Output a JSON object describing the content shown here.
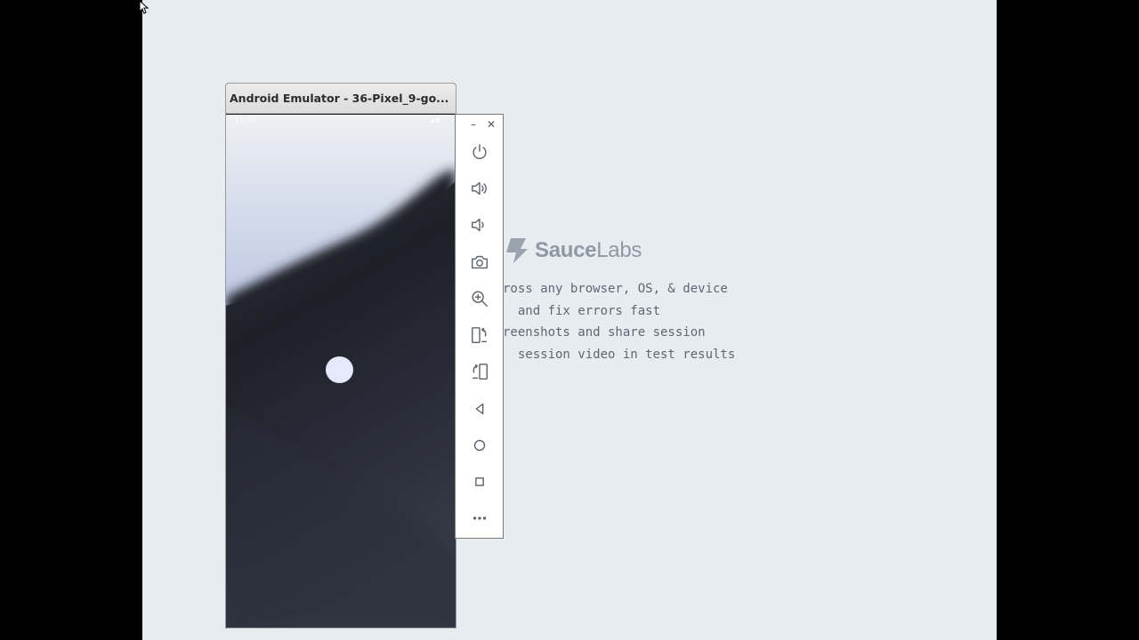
{
  "emulator": {
    "title": "Android Emulator - 36-Pixel_9-go...",
    "status_time": "11:55",
    "status_icons": "◢ ▮"
  },
  "toolbar": {
    "minimize": "–",
    "close": "✕",
    "buttons": [
      {
        "name": "power-icon"
      },
      {
        "name": "volume-up-icon"
      },
      {
        "name": "volume-down-icon"
      },
      {
        "name": "camera-icon"
      },
      {
        "name": "zoom-icon"
      },
      {
        "name": "rotate-left-icon"
      },
      {
        "name": "rotate-right-icon"
      },
      {
        "name": "back-icon"
      },
      {
        "name": "home-icon"
      },
      {
        "name": "overview-icon"
      },
      {
        "name": "more-icon"
      }
    ]
  },
  "sauce": {
    "logo_part1": "Sauce",
    "logo_part2": "Labs",
    "features": [
      "ross any browser, OS, & device",
      "  and fix errors fast",
      "reenshots and share session",
      "  session video in test results"
    ]
  },
  "colors": {
    "page_background": "#e7ecf1",
    "outer_background": "#000000",
    "logo_color": "#8f98a3",
    "text_color": "#5f6772"
  }
}
